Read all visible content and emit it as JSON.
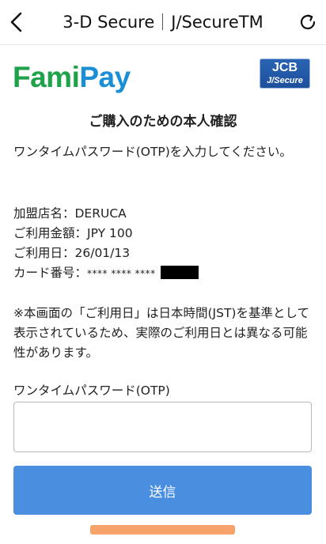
{
  "header": {
    "title_left": "3-D Secure",
    "title_right": "J/SecureTM",
    "back_icon": "chevron-left-icon",
    "reload_icon": "reload-icon"
  },
  "brand": {
    "logo_part1": "Fami",
    "logo_part2": "Pay",
    "jcb_line1": "JCB",
    "jcb_line2": "J/Secure"
  },
  "page": {
    "heading": "ご購入のための本人確認",
    "instruction": "ワンタイムパスワード(OTP)を入力してください。",
    "merchant": "加盟店名：DERUCA",
    "amount": "ご利用金額：JPY 100",
    "date": "ご利用日：26/01/13",
    "card_label": "カード番号：",
    "card_masked": "**** **** ****",
    "notice": "※本画面の「ご利用日」は日本時間(JST)を基準として表示されているため、実際のご利用日とは異なる可能性があります。"
  },
  "form": {
    "otp_label": "ワンタイムパスワード(OTP)",
    "otp_value": "",
    "submit_label": "送信"
  },
  "colors": {
    "fami": "#1fa34a",
    "pay": "#1a8fd6",
    "submit": "#4a8ee0",
    "jcb": "#1d4f9b",
    "bottom_bar": "#f7a26a"
  }
}
